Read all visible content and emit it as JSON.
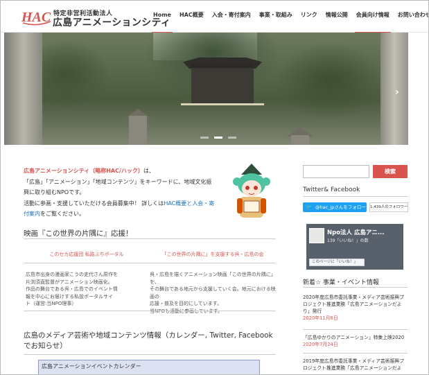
{
  "header": {
    "logo_text": "HAC",
    "org_type": "特定非営利活動法人",
    "org_name": "広島アニメーションシティ"
  },
  "nav": {
    "items": [
      "Home",
      "HAC概要",
      "入会・寄付案内",
      "事業・取組み",
      "リンク",
      "情報公開",
      "会員向け情報",
      "お問い合わせ"
    ]
  },
  "hero": {
    "next_arrow": "›"
  },
  "intro": {
    "org_highlight": "広島アニメーションシティ（略称HAC/ハック）",
    "line1_suffix": "は、",
    "line2": "「広島」「アニメーション」「地域コンテンツ」をキーワードに、地域文化振",
    "line3": "興に取り組むNPOです。",
    "line4_prefix": "活動に参画・支援していただける会員募集中！ 詳しくは",
    "line4_link": "HAC概要と入会・寄",
    "line5_link": "付案内",
    "line5_suffix": "をご覧ください。"
  },
  "movie_section": {
    "title": "映画『この世界の片隅に』応援！",
    "left_link": "このセカ応援団 私路ぶちポータル",
    "right_link": "「この世界の片隅に」を支援する呉・広島の会",
    "left_text": [
      "広島市出身の漫画家こうの史代さん原作を",
      "片渕須直監督がアニメーション映画化。",
      "作品の舞台である呉・広島でのイベント情",
      "報を中心にお届けする私設ポータルサイ",
      "ト（運営:当NPO理事）"
    ],
    "right_text": [
      "呉・広島を描くアニメーション映画「この世界の片隅に」を、",
      "その舞台である地元から支援していく会。地元における映画の",
      "応援・普及を目的にしています。",
      "当NPOも活動に参画しています。"
    ]
  },
  "media_section": {
    "title": "広島のメディア芸術や地域コンテンツ情報（カレンダー, Twitter, Facebookでお知らせ）",
    "calendar_title": "広島アニメーションイベントカレンダー"
  },
  "sidebar": {
    "search_placeholder": "",
    "search_button": "検索",
    "social_title": "Twitter& Facebook",
    "twitter_follow": "@hac_jpさんをフォロー",
    "twitter_followers": "1,439人のフォロワー",
    "fb_page_name": "Npo法人 広島アニ...",
    "fb_likes": "139「いいね！」の数",
    "fb_like_button": "このページに「いいね！」",
    "news_title": "新着☆ 事業・イベント情報",
    "news": [
      {
        "title": "2020年度広島市委託事業・メディア芸術振興プロジェクト推進業務「広島アニメーションだより」発行",
        "date": "2020年11月8日"
      },
      {
        "title": "「広島ゆかりのアニメーション」特集上映2020",
        "date": "2020年7月24日"
      },
      {
        "title": "2019年度広島市委託事業・メディア芸術振興プロジェクト推進業務「広島アニメーションだよ",
        "date": ""
      }
    ]
  },
  "colors": {
    "accent": "#d9534f",
    "link": "#1e73be",
    "twitter": "#1da1f2"
  }
}
